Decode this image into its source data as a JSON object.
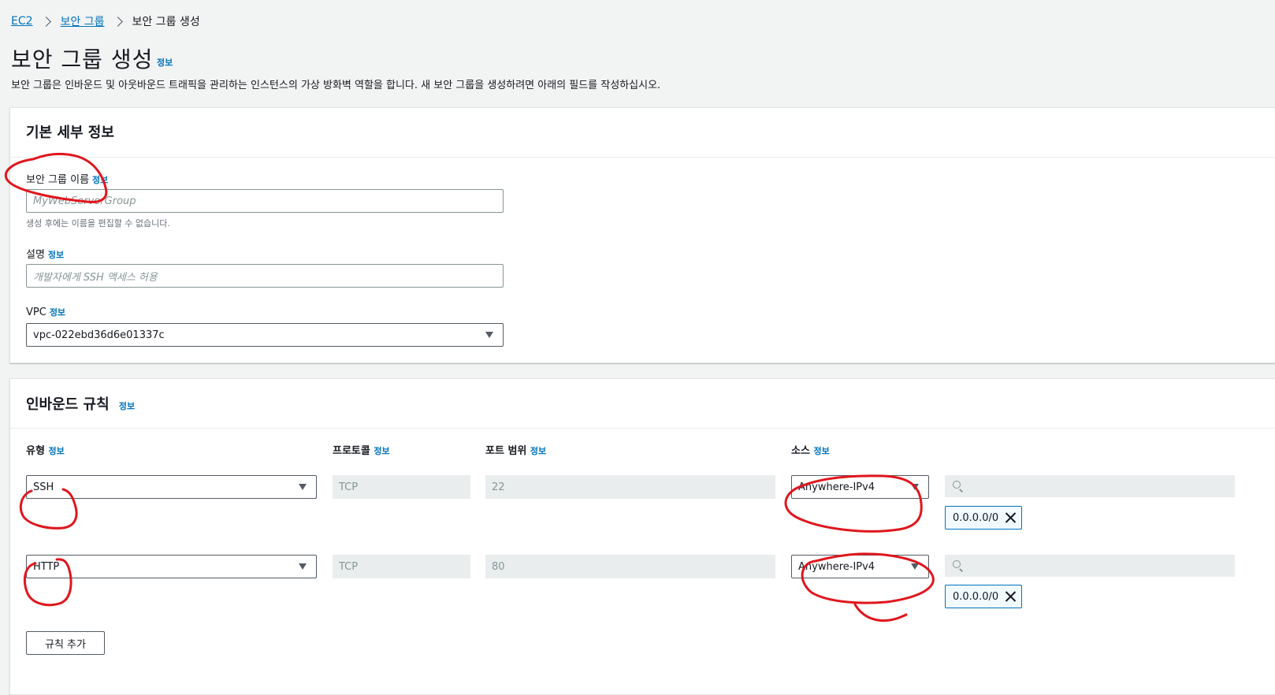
{
  "breadcrumb": {
    "items": [
      "EC2",
      "보안 그룹"
    ],
    "current": "보안 그룹 생성"
  },
  "page": {
    "title": "보안 그룹 생성",
    "info": "정보",
    "description": "보안 그룹은 인바운드 및 아웃바운드 트래픽을 관리하는 인스턴스의 가상 방화벽 역할을 합니다. 새 보안 그룹을 생성하려면 아래의 필드를 작성하십시오."
  },
  "basic": {
    "title": "기본 세부 정보",
    "name_label": "보안 그룹 이름",
    "name_info": "정보",
    "name_placeholder": "MyWebServerGroup",
    "name_hint": "생성 후에는 이름을 편집할 수 없습니다.",
    "desc_label": "설명",
    "desc_info": "정보",
    "desc_placeholder": "개발자에게 SSH 액세스 허용",
    "vpc_label": "VPC",
    "vpc_info": "정보",
    "vpc_value": "vpc-022ebd36d6e01337c"
  },
  "inbound": {
    "title": "인바운드 규칙",
    "info": "정보",
    "columns": {
      "type": "유형",
      "protocol": "프로토콜",
      "port": "포트 범위",
      "source": "소스",
      "info": "정보"
    },
    "rules": [
      {
        "type": "SSH",
        "protocol": "TCP",
        "port": "22",
        "source": "Anywhere-IPv4",
        "cidr": "0.0.0.0/0"
      },
      {
        "type": "HTTP",
        "protocol": "TCP",
        "port": "80",
        "source": "Anywhere-IPv4",
        "cidr": "0.0.0.0/0"
      }
    ],
    "add_rule": "규칙 추가"
  },
  "annotation_color": "#e0161d"
}
